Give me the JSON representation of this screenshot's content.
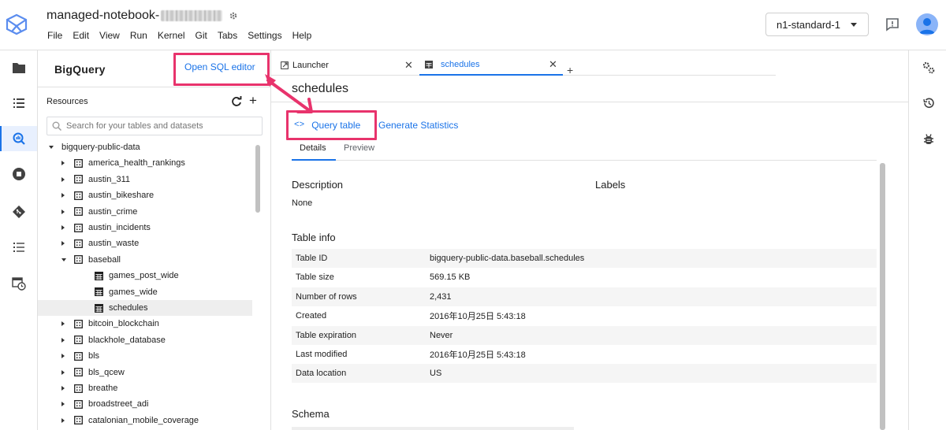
{
  "header": {
    "notebook_title": "managed-notebook-",
    "menu": [
      "File",
      "Edit",
      "View",
      "Run",
      "Kernel",
      "Git",
      "Tabs",
      "Settings",
      "Help"
    ],
    "machine_type": "n1-standard-1"
  },
  "rail_icons": [
    "folder-icon",
    "list-icon",
    "bigquery-icon",
    "stop-icon",
    "git-icon",
    "toc-icon",
    "schedule-icon"
  ],
  "panel": {
    "title": "BigQuery",
    "open_sql_label": "Open SQL editor",
    "resources_label": "Resources",
    "search_placeholder": "Search for your tables and datasets",
    "tree": [
      {
        "label": "bigquery-public-data",
        "level": 0,
        "kind": "project",
        "expanded": true
      },
      {
        "label": "america_health_rankings",
        "level": 1,
        "kind": "dataset"
      },
      {
        "label": "austin_311",
        "level": 1,
        "kind": "dataset"
      },
      {
        "label": "austin_bikeshare",
        "level": 1,
        "kind": "dataset"
      },
      {
        "label": "austin_crime",
        "level": 1,
        "kind": "dataset"
      },
      {
        "label": "austin_incidents",
        "level": 1,
        "kind": "dataset"
      },
      {
        "label": "austin_waste",
        "level": 1,
        "kind": "dataset"
      },
      {
        "label": "baseball",
        "level": 1,
        "kind": "dataset",
        "expanded": true
      },
      {
        "label": "games_post_wide",
        "level": 2,
        "kind": "table"
      },
      {
        "label": "games_wide",
        "level": 2,
        "kind": "table"
      },
      {
        "label": "schedules",
        "level": 2,
        "kind": "table",
        "selected": true
      },
      {
        "label": "bitcoin_blockchain",
        "level": 1,
        "kind": "dataset"
      },
      {
        "label": "blackhole_database",
        "level": 1,
        "kind": "dataset"
      },
      {
        "label": "bls",
        "level": 1,
        "kind": "dataset"
      },
      {
        "label": "bls_qcew",
        "level": 1,
        "kind": "dataset"
      },
      {
        "label": "breathe",
        "level": 1,
        "kind": "dataset"
      },
      {
        "label": "broadstreet_adi",
        "level": 1,
        "kind": "dataset"
      },
      {
        "label": "catalonian_mobile_coverage",
        "level": 1,
        "kind": "dataset"
      }
    ]
  },
  "tabs": [
    {
      "label": "Launcher",
      "active": false
    },
    {
      "label": "schedules",
      "active": true
    }
  ],
  "main": {
    "title": "schedules",
    "query_table_code": "<>",
    "query_table_label": "Query table",
    "generate_stats_label": "Generate Statistics",
    "subtabs": [
      "Details",
      "Preview"
    ],
    "description_label": "Description",
    "description_value": "None",
    "labels_label": "Labels",
    "table_info_label": "Table info",
    "table_info": [
      {
        "key": "Table ID",
        "value": "bigquery-public-data.baseball.schedules"
      },
      {
        "key": "Table size",
        "value": "569.15 KB"
      },
      {
        "key": "Number of rows",
        "value": "2,431"
      },
      {
        "key": "Created",
        "value": "2016年10月25日 5:43:18"
      },
      {
        "key": "Table expiration",
        "value": "Never"
      },
      {
        "key": "Last modified",
        "value": "2016年10月25日 5:43:18"
      },
      {
        "key": "Data location",
        "value": "US"
      }
    ],
    "schema_label": "Schema"
  },
  "right_rail_icons": [
    "property-inspector-icon",
    "history-icon",
    "debugger-icon"
  ],
  "colors": {
    "accent": "#1a73e8",
    "highlight": "#e8336c"
  }
}
